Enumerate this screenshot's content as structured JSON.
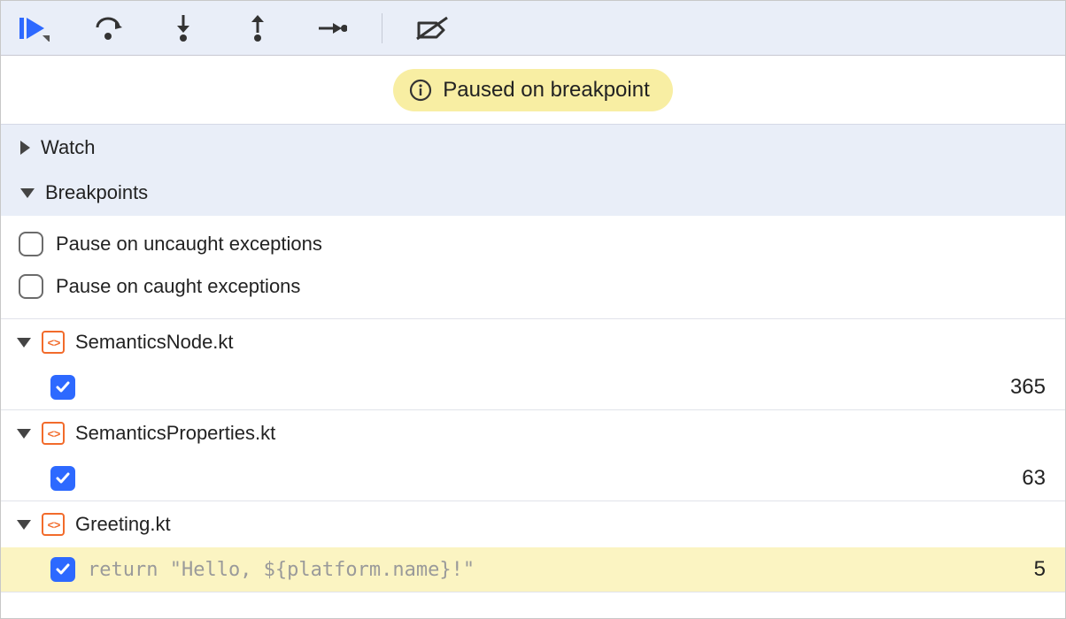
{
  "status": {
    "text": "Paused on breakpoint"
  },
  "sections": {
    "watch": {
      "title": "Watch",
      "expanded": false
    },
    "breakpoints": {
      "title": "Breakpoints",
      "expanded": true
    }
  },
  "options": {
    "pause_uncaught": {
      "label": "Pause on uncaught exceptions",
      "checked": false
    },
    "pause_caught": {
      "label": "Pause on caught exceptions",
      "checked": false
    }
  },
  "groups": [
    {
      "file": "SemanticsNode.kt",
      "expanded": true,
      "breakpoints": [
        {
          "enabled": true,
          "code": "",
          "line": 365,
          "active": false
        }
      ]
    },
    {
      "file": "SemanticsProperties.kt",
      "expanded": true,
      "breakpoints": [
        {
          "enabled": true,
          "code": "",
          "line": 63,
          "active": false
        }
      ]
    },
    {
      "file": "Greeting.kt",
      "expanded": true,
      "breakpoints": [
        {
          "enabled": true,
          "code": "return \"Hello, ${platform.name}!\"",
          "line": 5,
          "active": true
        }
      ]
    }
  ]
}
